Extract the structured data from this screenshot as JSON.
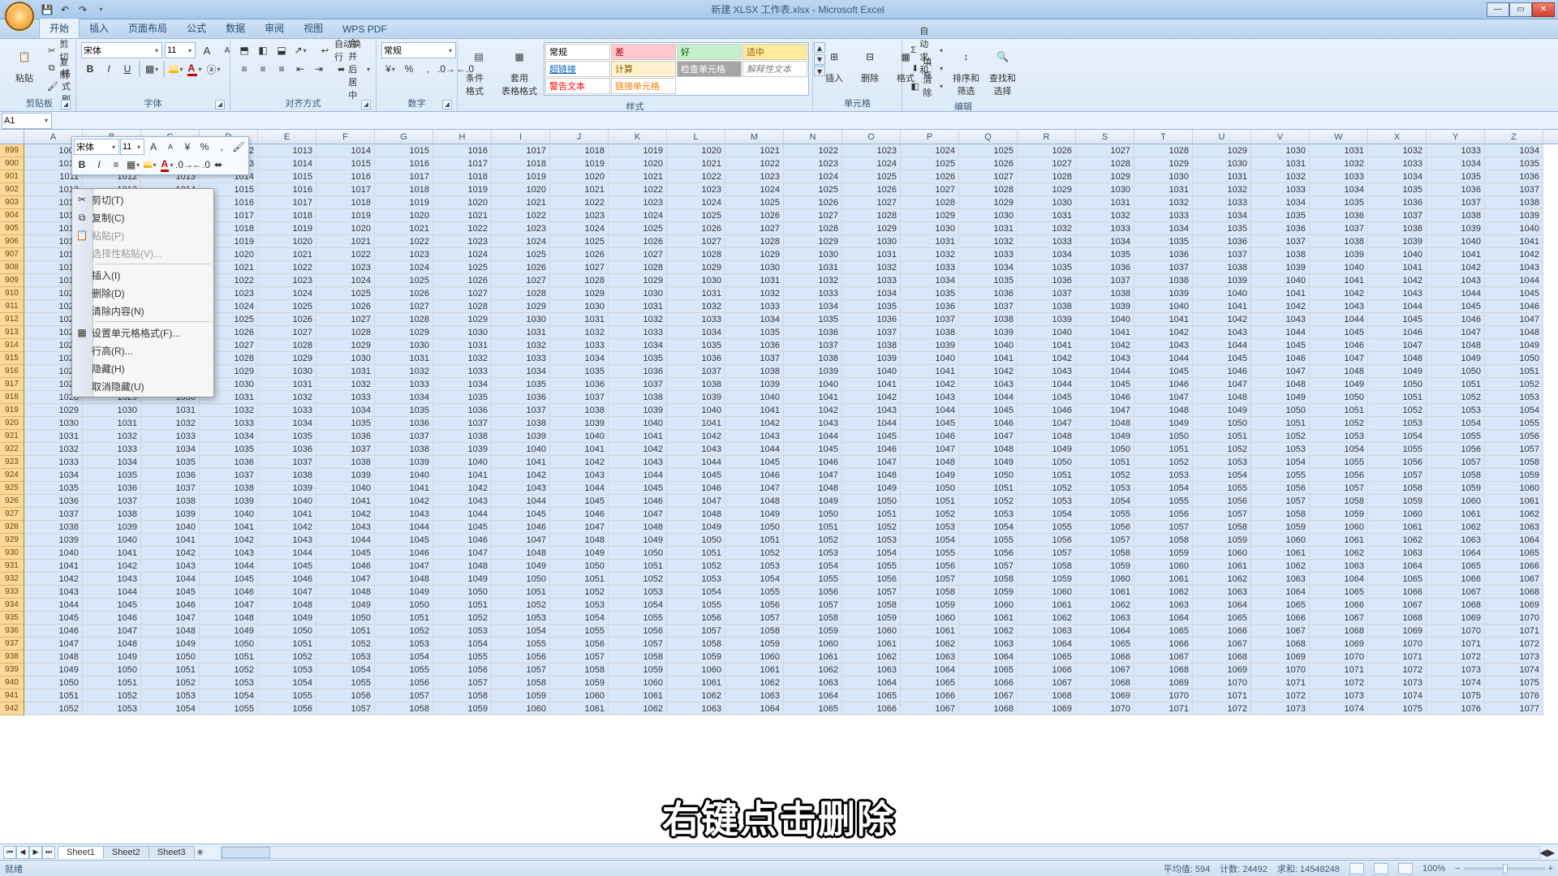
{
  "title": "新建 XLSX 工作表.xlsx - Microsoft Excel",
  "tabs": [
    "开始",
    "插入",
    "页面布局",
    "公式",
    "数据",
    "审阅",
    "视图",
    "WPS PDF"
  ],
  "active_tab": 0,
  "ribbon": {
    "clipboard": {
      "label": "剪贴板",
      "paste": "粘贴",
      "cut": "剪切",
      "copy": "复制",
      "format_painter": "格式刷"
    },
    "font": {
      "label": "字体",
      "name": "宋体",
      "size": "11"
    },
    "align": {
      "label": "对齐方式",
      "wrap": "自动换行",
      "merge": "合并后居中"
    },
    "number": {
      "label": "数字",
      "format": "常规"
    },
    "styles": {
      "label": "样式",
      "cond": "条件格式",
      "table": "套用\n表格格式",
      "cells": [
        {
          "t": "常规",
          "bg": "#ffffff",
          "c": "#000"
        },
        {
          "t": "差",
          "bg": "#ffc7ce",
          "c": "#9c0006"
        },
        {
          "t": "好",
          "bg": "#c6efce",
          "c": "#006100"
        },
        {
          "t": "适中",
          "bg": "#ffeb9c",
          "c": "#9c5700"
        },
        {
          "t": "超链接",
          "bg": "#ffffff",
          "c": "#0563c1",
          "u": true
        },
        {
          "t": "计算",
          "bg": "#fff2cc",
          "c": "#7f6000"
        },
        {
          "t": "检查单元格",
          "bg": "#a5a5a5",
          "c": "#ffffff"
        },
        {
          "t": "解释性文本",
          "bg": "#ffffff",
          "c": "#7f7f7f",
          "i": true
        },
        {
          "t": "警告文本",
          "bg": "#ffffff",
          "c": "#ff0000"
        },
        {
          "t": "链接单元格",
          "bg": "#ffffff",
          "c": "#fa7d00"
        }
      ]
    },
    "cells_grp": {
      "label": "单元格",
      "insert": "插入",
      "delete": "删除",
      "format": "格式"
    },
    "editing": {
      "label": "编辑",
      "autosum": "自动求和",
      "fill": "填充",
      "clear": "清除",
      "sort": "排序和\n筛选",
      "find": "查找和\n选择"
    }
  },
  "namebox": "A1",
  "mini_toolbar": {
    "font": "宋体",
    "size": "11"
  },
  "context_menu": {
    "items": [
      {
        "t": "剪切(T)",
        "ico": "✂"
      },
      {
        "t": "复制(C)",
        "ico": "⧉"
      },
      {
        "t": "粘贴(P)",
        "ico": "📋",
        "disabled": true
      },
      {
        "t": "选择性粘贴(V)...",
        "disabled": true
      },
      {
        "sep": true
      },
      {
        "t": "插入(I)"
      },
      {
        "t": "删除(D)"
      },
      {
        "t": "清除内容(N)"
      },
      {
        "sep": true
      },
      {
        "t": "设置单元格格式(F)...",
        "ico": "▦"
      },
      {
        "t": "行高(R)..."
      },
      {
        "t": "隐藏(H)"
      },
      {
        "t": "取消隐藏(U)"
      }
    ]
  },
  "grid": {
    "cols": [
      "A",
      "B",
      "C",
      "D",
      "E",
      "F",
      "G",
      "H",
      "I",
      "J",
      "K",
      "L",
      "M",
      "N",
      "O",
      "P",
      "Q",
      "R",
      "S",
      "T",
      "U",
      "V",
      "W",
      "X",
      "Y",
      "Z"
    ],
    "first_row_number": 899,
    "row_count": 44,
    "first_A_value": 1009,
    "col_count": 26
  },
  "sheet_tabs": [
    "Sheet1",
    "Sheet2",
    "Sheet3"
  ],
  "active_sheet": 0,
  "status": {
    "ready": "就绪",
    "avg_label": "平均值:",
    "avg": "594",
    "count_label": "计数:",
    "count": "24492",
    "sum_label": "求和:",
    "sum": "14548248",
    "zoom": "100%"
  },
  "caption": "右键点击删除"
}
